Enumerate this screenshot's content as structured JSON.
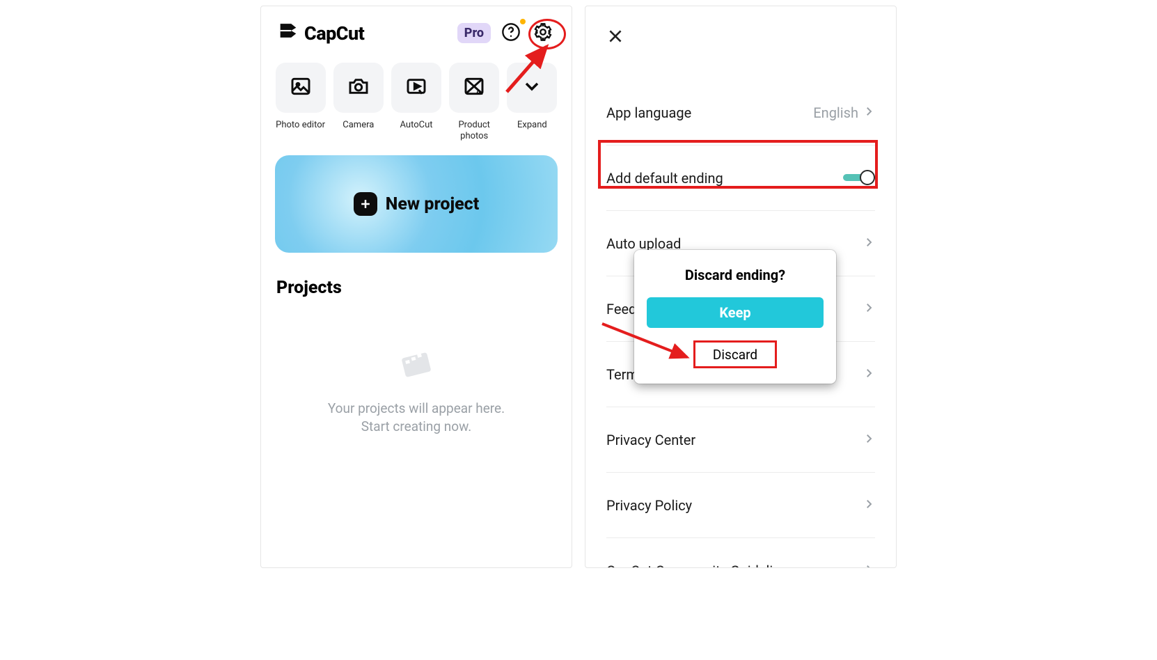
{
  "home": {
    "app_name": "CapCut",
    "pro_label": "Pro",
    "tools": [
      {
        "label": "Photo editor"
      },
      {
        "label": "Camera"
      },
      {
        "label": "AutoCut"
      },
      {
        "label": "Product\nphotos"
      },
      {
        "label": "Expand"
      }
    ],
    "new_project_label": "New project",
    "projects_title": "Projects",
    "empty_text": "Your projects will appear here.\nStart creating now."
  },
  "settings": {
    "rows": [
      {
        "label": "App language",
        "value": "English"
      },
      {
        "label": "Add default ending"
      },
      {
        "label": "Auto upload"
      },
      {
        "label": "Feedback"
      },
      {
        "label": "Terms"
      },
      {
        "label": "Privacy Center"
      },
      {
        "label": "Privacy Policy"
      },
      {
        "label": "CapCut Community Guidelines"
      }
    ],
    "dialog": {
      "title": "Discard ending?",
      "keep": "Keep",
      "discard": "Discard"
    }
  }
}
